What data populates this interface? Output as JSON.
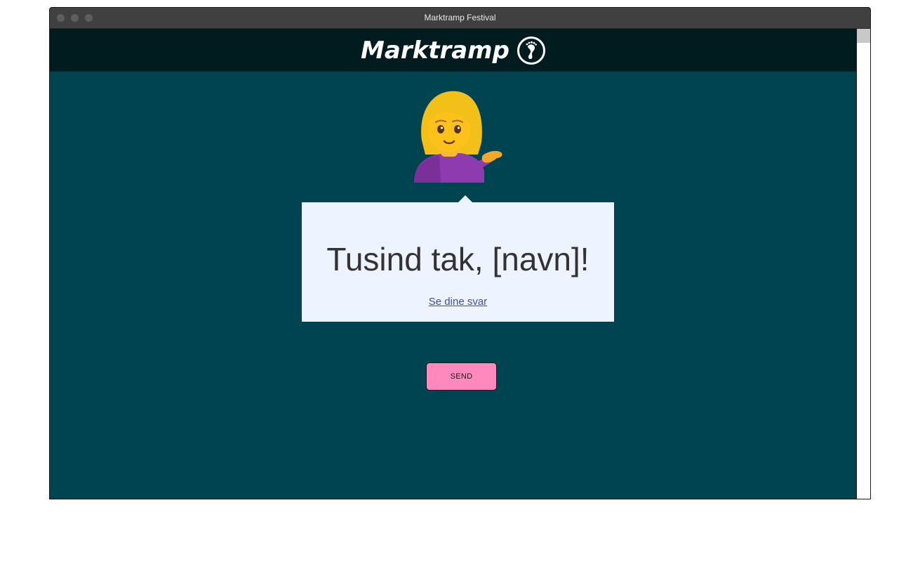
{
  "window": {
    "title": "Marktramp Festival"
  },
  "header": {
    "logo_text": "Marktramp",
    "logo_icon": "footprint-icon"
  },
  "avatar": {
    "icon": "woman-tipping-hand-icon"
  },
  "bubble": {
    "heading": "Tusind tak, [navn]!",
    "link_text": "Se dine svar"
  },
  "form": {
    "send_label": "SEND"
  },
  "colors": {
    "page_background": "#004451",
    "header_background": "#001c1f",
    "bubble_background": "#edf3ff",
    "send_button": "#ff89bd",
    "link": "#3e4fa8"
  }
}
